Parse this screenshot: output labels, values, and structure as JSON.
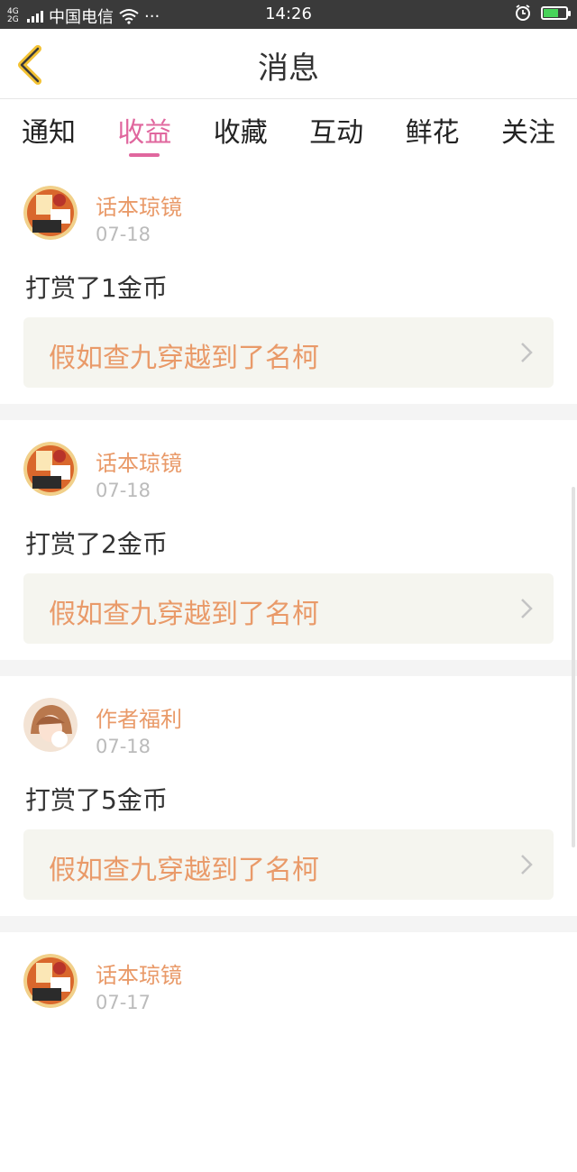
{
  "status_bar": {
    "network": "4G\n2G",
    "carrier": "中国电信",
    "more": "···",
    "time": "14:26",
    "icons": [
      "signal-icon",
      "wifi-icon",
      "alarm-icon",
      "battery-charging-icon"
    ]
  },
  "header": {
    "title": "消息",
    "back_icon": "chevron-left-icon"
  },
  "tabs": [
    {
      "label": "通知",
      "active": false
    },
    {
      "label": "收益",
      "active": true
    },
    {
      "label": "收藏",
      "active": false
    },
    {
      "label": "互动",
      "active": false
    },
    {
      "label": "鲜花",
      "active": false
    },
    {
      "label": "关注",
      "active": false
    }
  ],
  "colors": {
    "accent": "#e0679e",
    "name": "#e99a69",
    "book_bg": "#f5f5ef"
  },
  "messages": [
    {
      "name": "话本琼镜",
      "date": "07-18",
      "text": "打赏了1金币",
      "book": "假如查九穿越到了名柯",
      "avatar": "avatar-huaben"
    },
    {
      "name": "话本琼镜",
      "date": "07-18",
      "text": "打赏了2金币",
      "book": "假如查九穿越到了名柯",
      "avatar": "avatar-huaben"
    },
    {
      "name": "作者福利",
      "date": "07-18",
      "text": "打赏了5金币",
      "book": "假如查九穿越到了名柯",
      "avatar": "avatar-author"
    },
    {
      "name": "话本琼镜",
      "date": "07-17",
      "text": "",
      "book": "",
      "avatar": "avatar-huaben"
    }
  ]
}
